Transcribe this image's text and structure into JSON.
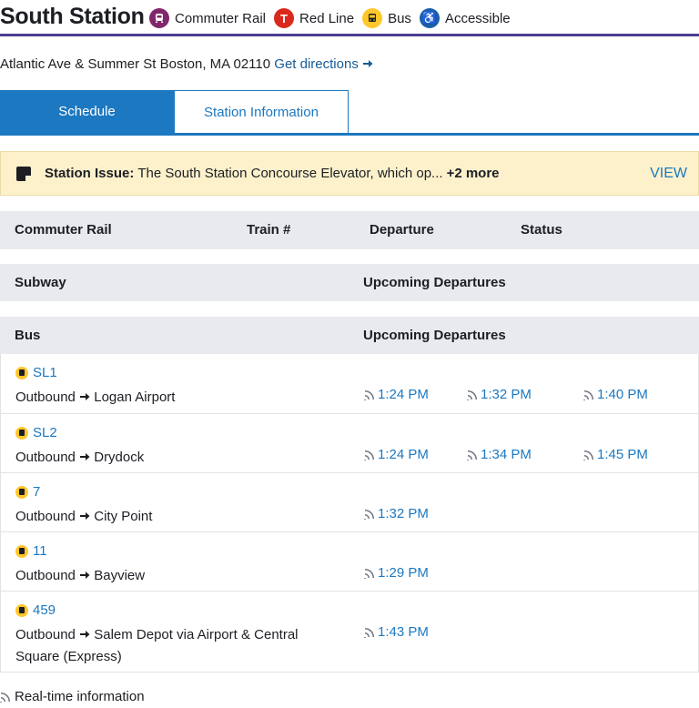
{
  "header": {
    "title": "South Station",
    "modes": [
      {
        "label": "Commuter Rail",
        "icon": "commuter-rail-icon",
        "color": "#80276c"
      },
      {
        "label": "Red Line",
        "icon": "red-line-icon",
        "color": "#da291c",
        "glyph": "T"
      },
      {
        "label": "Bus",
        "icon": "bus-icon",
        "color": "#ffc72c"
      },
      {
        "label": "Accessible",
        "icon": "accessible-icon",
        "color": "#1c5fa8",
        "glyph": "♿"
      }
    ]
  },
  "address": {
    "text": "Atlantic Ave & Summer St Boston, MA 02110",
    "directions": "Get directions"
  },
  "tabs": {
    "schedule": "Schedule",
    "station_info": "Station Information"
  },
  "alert": {
    "label": "Station Issue:",
    "text": "The South Station Concourse Elevator, which op...",
    "more": "+2 more",
    "view": "VIEW"
  },
  "commuter_rail": {
    "col1": "Commuter Rail",
    "col2": "Train #",
    "col3": "Departure",
    "col4": "Status"
  },
  "subway": {
    "col1": "Subway",
    "col2": "Upcoming Departures"
  },
  "bus": {
    "col1": "Bus",
    "col2": "Upcoming Departures"
  },
  "routes": [
    {
      "number": "SL1",
      "direction": "Outbound",
      "destination": "Logan Airport",
      "times": [
        "1:24 PM",
        "1:32 PM",
        "1:40 PM"
      ]
    },
    {
      "number": "SL2",
      "direction": "Outbound",
      "destination": "Drydock",
      "times": [
        "1:24 PM",
        "1:34 PM",
        "1:45 PM"
      ]
    },
    {
      "number": "7",
      "direction": "Outbound",
      "destination": "City Point",
      "times": [
        "1:32 PM"
      ]
    },
    {
      "number": "11",
      "direction": "Outbound",
      "destination": "Bayview",
      "times": [
        "1:29 PM"
      ]
    },
    {
      "number": "459",
      "direction": "Outbound",
      "destination": "Salem Depot via Airport & Central Square (Express)",
      "times": [
        "1:43 PM"
      ]
    }
  ],
  "footer": {
    "label": "Real-time information"
  }
}
